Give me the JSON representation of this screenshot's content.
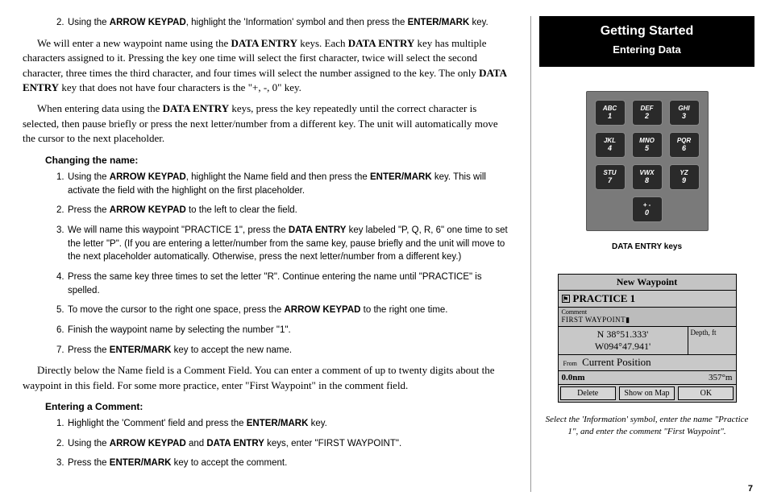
{
  "header": {
    "title": "Getting Started",
    "subtitle": "Entering Data"
  },
  "top_step": {
    "num": "2.",
    "pre": "Using the ",
    "b1": "ARROW KEYPAD",
    "mid": ", highlight the 'Information' symbol and then press the ",
    "b2": "ENTER/MARK",
    "post": " key."
  },
  "para1": {
    "a": "We will enter a new waypoint name using the ",
    "b1": "DATA ENTRY",
    "b": " keys. Each ",
    "b2": "DATA ENTRY",
    "c": " key has multiple characters assigned to it. Pressing the key one time will select the first character, twice will select the second character, three times the third character, and four times will select the number assigned to the key. The only ",
    "b3": "DATA ENTRY",
    "d": " key that does not have four characters is the \"+, -, 0\" key."
  },
  "para2": {
    "a": "When entering data using the ",
    "b1": "DATA ENTRY",
    "b": " keys, press the key repeatedly until the correct character is selected, then pause briefly or press the next letter/number from a different key. The unit will automatically move the cursor to the next placeholder."
  },
  "sub1": "Changing the name:",
  "steps1": [
    {
      "num": "1.",
      "parts": [
        "Using the ",
        "ARROW KEYPAD",
        ", highlight the Name field and then press the ",
        "ENTER/MARK",
        " key. This will activate the field with the highlight on the first placeholder."
      ]
    },
    {
      "num": "2.",
      "parts": [
        "Press the ",
        "ARROW KEYPAD",
        " to the left to clear the field."
      ]
    },
    {
      "num": "3.",
      "parts": [
        "We will name this waypoint \"PRACTICE 1\", press the ",
        "DATA ENTRY",
        " key labeled \"P, Q, R, 6\" one time to set the letter \"P\". (If you are entering a letter/number from the same key, pause briefly and the unit will move to the next placeholder automatically. Otherwise, press the next letter/number from a different key.)"
      ]
    },
    {
      "num": "4.",
      "parts": [
        "Press the same key three times to set the letter \"R\". Continue entering the name until \"PRACTICE\" is spelled."
      ]
    },
    {
      "num": "5.",
      "parts": [
        "To move the cursor to the right one space, press the ",
        "ARROW KEYPAD",
        " to the right one time."
      ]
    },
    {
      "num": "6.",
      "parts": [
        "Finish the waypoint name by selecting the number \"1\"."
      ]
    },
    {
      "num": "7.",
      "parts": [
        "Press the ",
        "ENTER/MARK",
        " key to accept the new name."
      ]
    }
  ],
  "para3": "Directly below the Name field is a Comment Field. You can enter a comment of up to twenty digits about the waypoint in this field. For some more practice, enter \"First Waypoint\" in the comment field.",
  "sub2": "Entering a Comment:",
  "steps2": [
    {
      "num": "1.",
      "parts": [
        "Highlight the 'Comment' field and press the ",
        "ENTER/MARK",
        " key."
      ]
    },
    {
      "num": "2.",
      "parts": [
        "Using the ",
        "ARROW KEYPAD",
        " and ",
        "DATA ENTRY",
        " keys, enter \"FIRST WAYPOINT\"."
      ]
    },
    {
      "num": "3.",
      "parts": [
        "Press the ",
        "ENTER/MARK",
        " key to accept the comment."
      ]
    }
  ],
  "keypad": {
    "keys": [
      {
        "l": "ABC",
        "n": "1"
      },
      {
        "l": "DEF",
        "n": "2"
      },
      {
        "l": "GHI",
        "n": "3"
      },
      {
        "l": "JKL",
        "n": "4"
      },
      {
        "l": "MNO",
        "n": "5"
      },
      {
        "l": "PQR",
        "n": "6"
      },
      {
        "l": "STU",
        "n": "7"
      },
      {
        "l": "VWX",
        "n": "8"
      },
      {
        "l": "YZ",
        "n": "9"
      }
    ],
    "zero": {
      "l": "+ -",
      "n": "0"
    },
    "caption": "DATA ENTRY keys"
  },
  "waypoint": {
    "title": "New Waypoint",
    "flag": "⚑",
    "name": "PRACTICE 1",
    "comment_lbl": "Comment",
    "comment_val": "FIRST WAYPOINT",
    "lat": "N  38°51.333'",
    "lon": "W094°47.941'",
    "depth_lbl": "Depth, ft",
    "from_lbl": "From",
    "from_val": "Current Position",
    "dist": "0.0nm",
    "brg": "357°m",
    "btn1": "Delete",
    "btn2": "Show on Map",
    "btn3": "OK"
  },
  "caption2": "Select the 'Information' symbol, enter the name \"Practice 1\", and enter the comment \"First Waypoint\".",
  "page": "7"
}
